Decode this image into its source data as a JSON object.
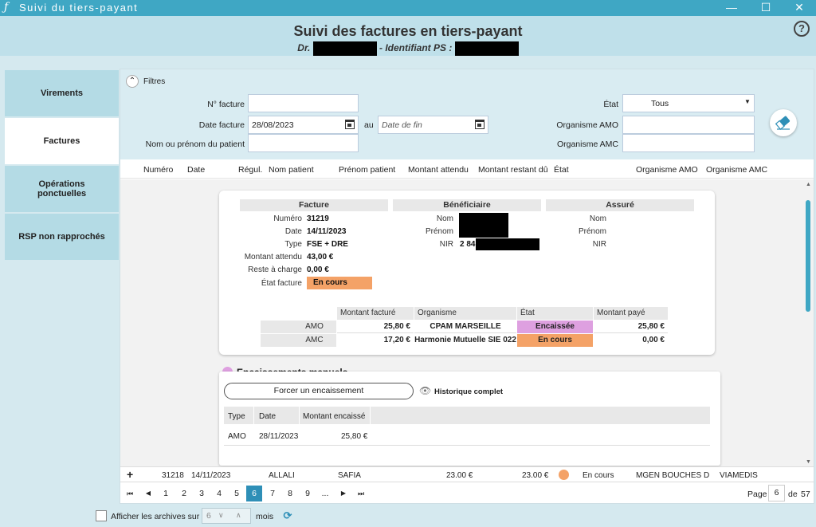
{
  "window": {
    "title": "Suivi du tiers-payant",
    "logo": "ƒ",
    "minimize": "—",
    "maximize": "☐",
    "close": "✕"
  },
  "header": {
    "title": "Suivi des factures en tiers-payant",
    "dr_prefix": "Dr.",
    "ps_label": "- Identifiant PS :",
    "help": "?"
  },
  "nav": [
    {
      "label": "Virements"
    },
    {
      "label": "Factures"
    },
    {
      "label": "Opérations ponctuelles"
    },
    {
      "label": "RSP non rapprochés"
    }
  ],
  "filters": {
    "title": "Filtres",
    "num_facture_label": "N° facture",
    "date_facture_label": "Date facture",
    "date_facture_value": "28/08/2023",
    "au_label": "au",
    "date_fin_placeholder": "Date de fin",
    "nom_label": "Nom ou prénom du patient",
    "etat_label": "État",
    "etat_value": "Tous",
    "amo_label": "Organisme AMO",
    "amc_label": "Organisme AMC"
  },
  "columns": [
    "Numéro",
    "Date",
    "Régul.",
    "Nom patient",
    "Prénom patient",
    "Montant attendu",
    "Montant restant dû",
    "État",
    "Organisme AMO",
    "Organisme AMC"
  ],
  "facture": {
    "section": "Facture",
    "numero_k": "Numéro",
    "numero_v": "31219",
    "date_k": "Date",
    "date_v": "14/11/2023",
    "type_k": "Type",
    "type_v": "FSE + DRE",
    "montant_k": "Montant attendu",
    "montant_v": "43,00 €",
    "reste_k": "Reste à charge",
    "reste_v": "0,00 €",
    "etat_k": "État facture",
    "etat_v": "En cours"
  },
  "beneficiaire": {
    "section": "Bénéficiaire",
    "nom_k": "Nom",
    "prenom_k": "Prénom",
    "nir_k": "NIR",
    "nir_v": "2 84"
  },
  "assure": {
    "section": "Assuré",
    "nom_k": "Nom",
    "prenom_k": "Prénom",
    "nir_k": "NIR"
  },
  "orgtable": {
    "headers": [
      "Montant facturé",
      "Organisme",
      "État",
      "Montant payé"
    ],
    "rows": [
      {
        "type": "AMO",
        "facture": "25,80 €",
        "organisme": "CPAM MARSEILLE",
        "etat": "Encaissée",
        "paye": "25,80 €"
      },
      {
        "type": "AMC",
        "facture": "17,20 €",
        "organisme": "Harmonie Mutuelle SIE 022",
        "etat": "En cours",
        "paye": "0,00 €"
      }
    ]
  },
  "encaissements": {
    "title": "Encaissements manuels",
    "force_button": "Forcer un encaissement",
    "historique": "Historique complet",
    "headers": [
      "Type",
      "Date",
      "Montant encaissé"
    ],
    "rows": [
      {
        "type": "AMO",
        "date": "28/11/2023",
        "montant": "25,80 €"
      }
    ]
  },
  "next_row": {
    "expand": "+",
    "numero": "31218",
    "date": "14/11/2023",
    "nom": "ALLALI",
    "prenom": "SAFIA",
    "attendu": "23.00 €",
    "restant": "23.00 €",
    "etat": "En cours",
    "amo": "MGEN BOUCHES D",
    "amc": "VIAMEDIS"
  },
  "pager": {
    "first": "⏮",
    "prev": "◀",
    "next": "▶",
    "last": "⏭",
    "pages": [
      "1",
      "2",
      "3",
      "4",
      "5",
      "6",
      "7",
      "8",
      "9",
      "..."
    ],
    "active": "6",
    "page_label": "Page",
    "page_value": "6",
    "of_label": "de",
    "total": "57"
  },
  "footer": {
    "archives_label": "Afficher les archives sur",
    "months_value": "6",
    "mois_label": "mois"
  },
  "colors": {
    "accent": "#3fa7c4",
    "header_bg": "#bfe0ea",
    "orange": "#f4a267",
    "pink": "#dea0e0",
    "active_page": "#2e8fb7"
  }
}
